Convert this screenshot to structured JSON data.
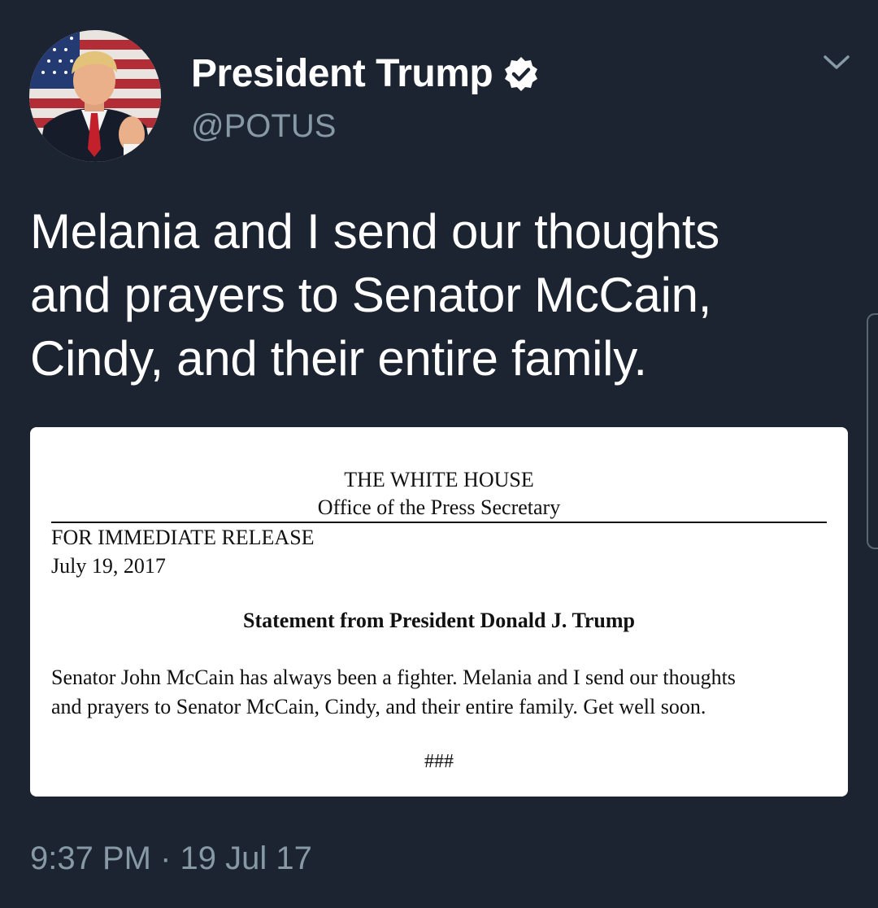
{
  "tweet": {
    "author": {
      "display_name": "President Trump",
      "handle": "@POTUS",
      "verified": true,
      "verified_icon": "verified-badge-icon",
      "avatar_icon": "profile-photo"
    },
    "menu_icon": "chevron-down-icon",
    "text": "Melania and I send our thoughts\nand prayers to Senator McCain,\nCindy, and their entire family.",
    "timestamp": "9:37 PM · 19 Jul 17"
  },
  "media": {
    "organization": "THE WHITE HOUSE",
    "office": "Office of the Press Secretary",
    "release_line": "FOR IMMEDIATE RELEASE",
    "date": "July 19, 2017",
    "statement_title": "Statement from President Donald J. Trump",
    "body": "Senator John McCain has always been a fighter.  Melania and I send our thoughts\nand prayers to Senator McCain, Cindy, and their entire family.  Get well soon.",
    "end_mark": "###"
  },
  "colors": {
    "background": "#1c2431",
    "primary_text": "#ffffff",
    "secondary_text": "#8899a6",
    "card_background": "#ffffff"
  }
}
